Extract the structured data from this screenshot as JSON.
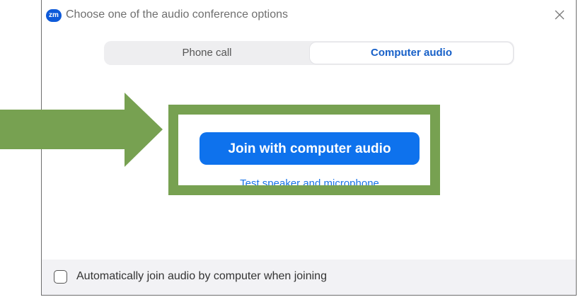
{
  "window": {
    "title": "Choose one of the audio conference options",
    "app_logo_text": "zm",
    "close_icon": "close-icon"
  },
  "tabs": [
    {
      "label": "Phone call",
      "selected": false
    },
    {
      "label": "Computer audio",
      "selected": true
    }
  ],
  "main": {
    "join_button_label": "Join with computer audio",
    "test_link_label": "Test speaker and microphone"
  },
  "footer": {
    "checkbox_label": "Automatically join audio by computer when joining",
    "checkbox_checked": false
  },
  "annotation": {
    "color": "#77a151",
    "shapes": [
      "arrow-right",
      "highlight-rectangle"
    ]
  },
  "colors": {
    "accent": "#0e72ed",
    "selected_tab_text": "#1760c8"
  }
}
